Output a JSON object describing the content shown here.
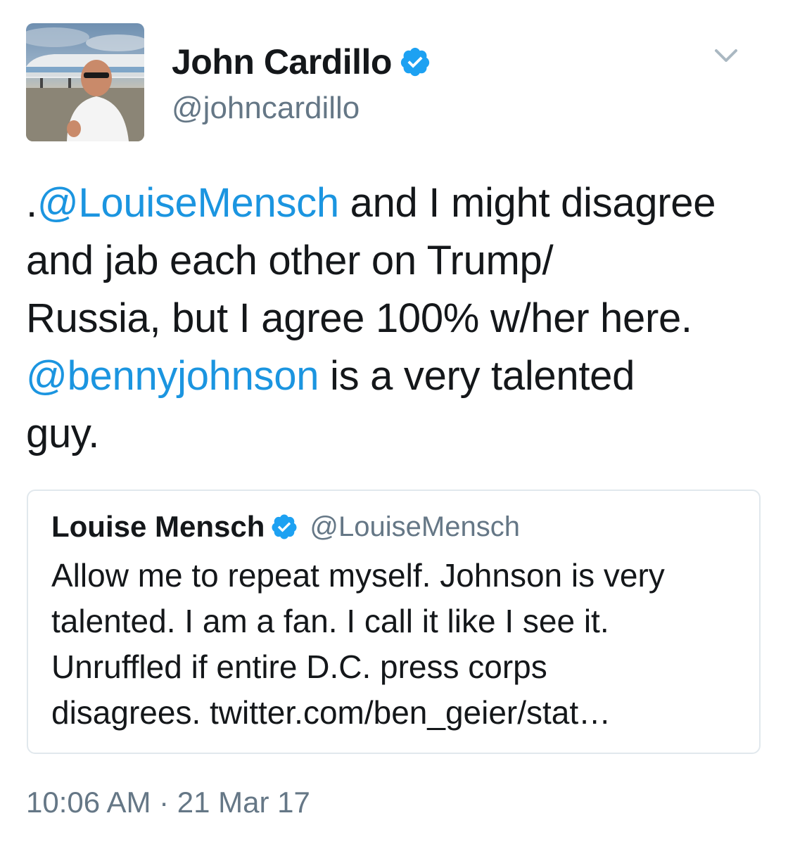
{
  "author": {
    "name": "John Cardillo",
    "handle": "@johncardillo",
    "verified": true
  },
  "tweet": {
    "lines": [
      [
        {
          "text": ".",
          "mention": false
        },
        {
          "text": "@LouiseMensch",
          "mention": true
        },
        {
          "text": " and I might disagree",
          "mention": false
        }
      ],
      [
        {
          "text": "and jab each other on Trump/",
          "mention": false
        }
      ],
      [
        {
          "text": "Russia, but I agree 100% w/her here.",
          "mention": false
        }
      ],
      [
        {
          "text": "@bennyjohnson",
          "mention": true
        },
        {
          "text": " is a very talented",
          "mention": false
        }
      ],
      [
        {
          "text": "guy.",
          "mention": false
        }
      ]
    ]
  },
  "quoted_tweet": {
    "name": "Louise Mensch",
    "handle": "@LouiseMensch",
    "verified": true,
    "lines": [
      "Allow me to repeat myself. Johnson is very",
      "talented. I am a fan. I call it like I see it.",
      "Unruffled if entire D.C. press corps",
      "disagrees. twitter.com/ben_geier/stat…"
    ]
  },
  "timestamp": "10:06 AM · 21 Mar 17",
  "colors": {
    "link": "#1b95e0",
    "secondary_text": "#657786",
    "verified_badge": "#1da1f2",
    "border": "#e1e8ed"
  },
  "icons": {
    "verified": "verified-badge-icon",
    "caret": "chevron-down-icon"
  }
}
